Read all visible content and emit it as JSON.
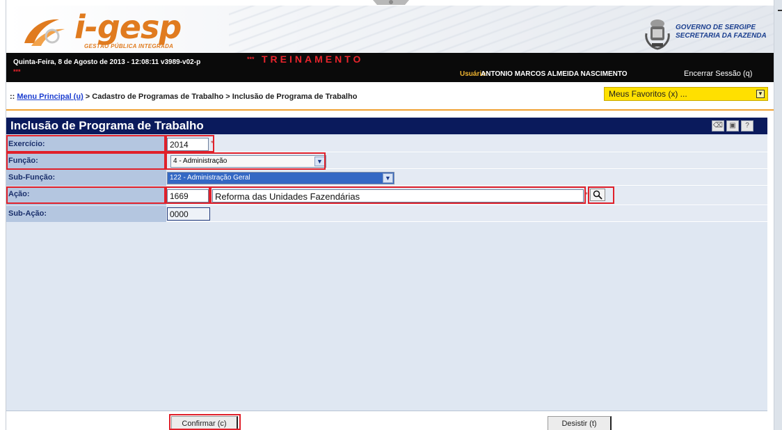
{
  "header": {
    "logo_name": "i-gesp",
    "logo_subtitle": "GESTÃO PÚBLICA INTEGRADA",
    "gov_line1": "GOVERNO DE SERGIPE",
    "gov_line2": "SECRETARIA DA FAZENDA"
  },
  "statusbar": {
    "datetime": "Quinta-Feira, 8 de Agosto de 2013 - 12:08:11  v3989-v02-p",
    "stars": "***",
    "mode": "TREINAMENTO",
    "stars2": "***",
    "user_label": "Usuário:",
    "user_name": "ANTONIO MARCOS ALMEIDA NASCIMENTO",
    "logout": "Encerrar Sessão (q)"
  },
  "breadcrumb": {
    "prefix": "::",
    "link": "Menu Principal (u)",
    "rest": "> Cadastro de Programas de Trabalho > Inclusão de Programa de Trabalho"
  },
  "favorites": {
    "label": "Meus Favoritos (x) ..."
  },
  "form": {
    "title": "Inclusão de Programa de Trabalho",
    "exercicio_label": "Exercício:",
    "exercicio_value": "2014",
    "funcao_label": "Função:",
    "funcao_value": "4 - Administração",
    "subfuncao_label": "Sub-Função:",
    "subfuncao_value": "122 - Administração Geral",
    "acao_label": "Ação:",
    "acao_code": "1669",
    "acao_desc": "Reforma das Unidades Fazendárias",
    "subacao_label": "Sub-Ação:",
    "subacao_value": "0000",
    "required_mark": "*"
  },
  "buttons": {
    "confirm": "Confirmar (c)",
    "cancel": "Desistir (t)"
  },
  "colors": {
    "brand_orange": "#e07b1f",
    "title_bar": "#0a1a5c",
    "label_bg": "#b4c6e0",
    "highlight": "#e0202a",
    "favorites_bg": "#ffe000"
  }
}
